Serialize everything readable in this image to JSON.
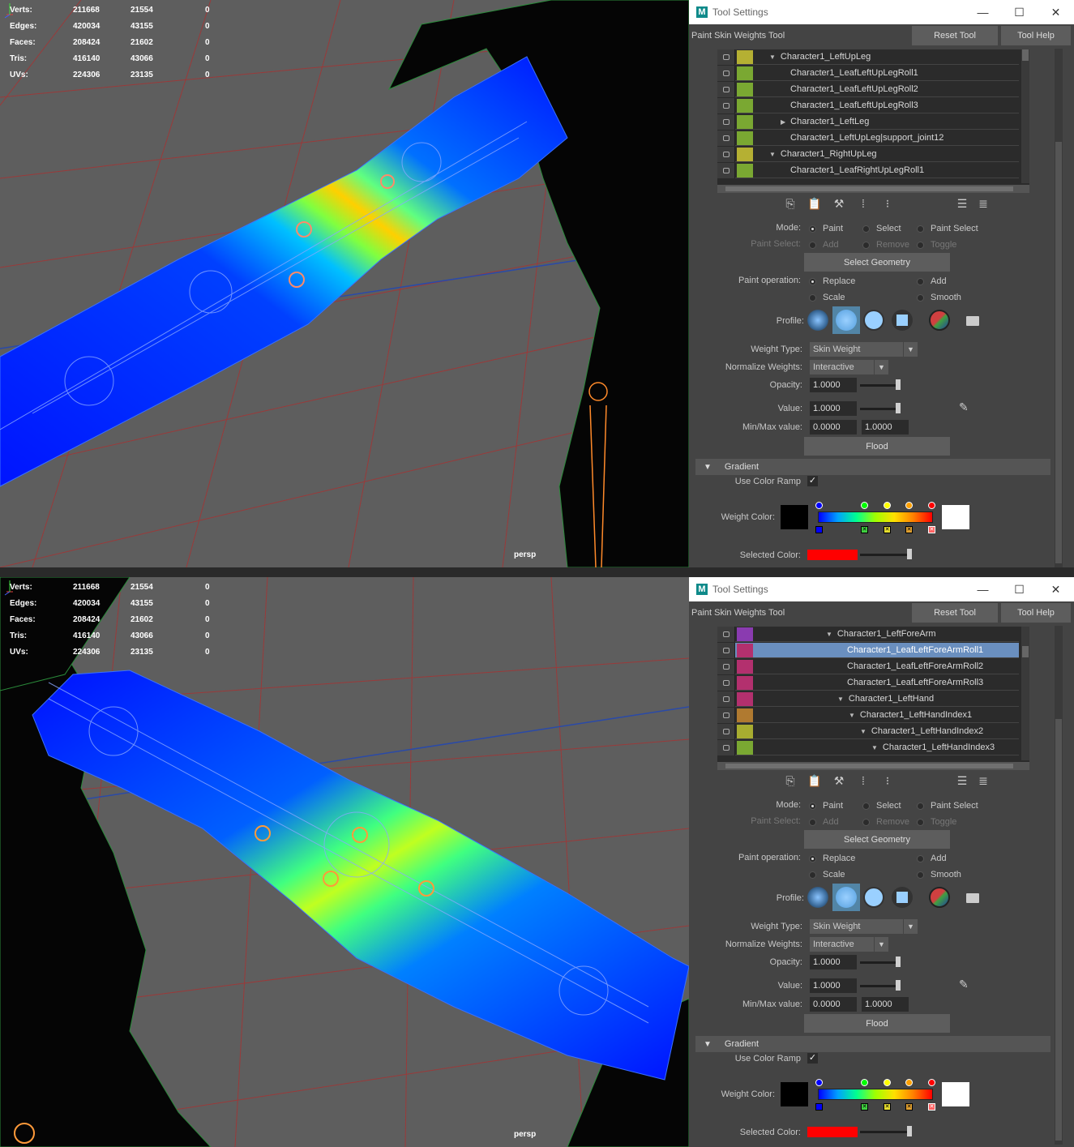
{
  "hud_stats": {
    "rows": [
      {
        "label": "Verts:",
        "v1": "211668",
        "v2": "21554",
        "v3": "0"
      },
      {
        "label": "Edges:",
        "v1": "420034",
        "v2": "43155",
        "v3": "0"
      },
      {
        "label": "Faces:",
        "v1": "208424",
        "v2": "21602",
        "v3": "0"
      },
      {
        "label": "Tris:",
        "v1": "416140",
        "v2": "43066",
        "v3": "0"
      },
      {
        "label": "UVs:",
        "v1": "224306",
        "v2": "23135",
        "v3": "0"
      }
    ]
  },
  "camera_label": "persp",
  "window": {
    "title": "Tool Settings",
    "minimize": "—",
    "maximize": "☐",
    "close": "✕"
  },
  "tool": {
    "name": "Paint Skin Weights Tool",
    "reset_label": "Reset Tool",
    "help_label": "Tool Help"
  },
  "joints_top": [
    {
      "name": "Character1_LeftUpLeg",
      "color": "#b5b033",
      "arrow": "▼"
    },
    {
      "name": "Character1_LeafLeftUpLegRoll1",
      "color": "#7aa832",
      "arrow": ""
    },
    {
      "name": "Character1_LeafLeftUpLegRoll2",
      "color": "#7aa832",
      "arrow": ""
    },
    {
      "name": "Character1_LeafLeftUpLegRoll3",
      "color": "#7aa832",
      "arrow": ""
    },
    {
      "name": "Character1_LeftLeg",
      "color": "#7aa832",
      "arrow": "▶"
    },
    {
      "name": "Character1_LeftUpLeg|support_joint12",
      "color": "#7aa832",
      "arrow": ""
    },
    {
      "name": "Character1_RightUpLeg",
      "color": "#b5b033",
      "arrow": "▼"
    },
    {
      "name": "Character1_LeafRightUpLegRoll1",
      "color": "#7aa832",
      "arrow": ""
    }
  ],
  "joints_bottom": [
    {
      "name": "Character1_LeftForeArm",
      "color": "#8a3bb0",
      "arrow": "▼"
    },
    {
      "name": "Character1_LeafLeftForeArmRoll1",
      "color": "#b3306e",
      "arrow": ""
    },
    {
      "name": "Character1_LeafLeftForeArmRoll2",
      "color": "#b3306e",
      "arrow": ""
    },
    {
      "name": "Character1_LeafLeftForeArmRoll3",
      "color": "#b3306e",
      "arrow": ""
    },
    {
      "name": "Character1_LeftHand",
      "color": "#b3306e",
      "arrow": "▼"
    },
    {
      "name": "Character1_LeftHandIndex1",
      "color": "#b07a30",
      "arrow": "▼"
    },
    {
      "name": "Character1_LeftHandIndex2",
      "color": "#a8ad30",
      "arrow": "▼"
    },
    {
      "name": "Character1_LeftHandIndex3",
      "color": "#7aa832",
      "arrow": "▼"
    }
  ],
  "mode": {
    "label": "Mode:",
    "paint": "Paint",
    "select": "Select",
    "paint_select": "Paint Select"
  },
  "paint_select": {
    "label": "Paint Select:",
    "add": "Add",
    "remove": "Remove",
    "toggle": "Toggle"
  },
  "select_geometry_label": "Select Geometry",
  "paint_operation": {
    "label": "Paint operation:",
    "replace": "Replace",
    "add": "Add",
    "scale": "Scale",
    "smooth": "Smooth"
  },
  "profile_label": "Profile:",
  "weight_type": {
    "label": "Weight Type:",
    "value": "Skin Weight"
  },
  "normalize": {
    "label": "Normalize Weights:",
    "value": "Interactive"
  },
  "opacity": {
    "label": "Opacity:",
    "value": "1.0000",
    "level": 1.0
  },
  "value": {
    "label": "Value:",
    "value": "1.0000",
    "level": 1.0
  },
  "minmax": {
    "label": "Min/Max value:",
    "min": "0.0000",
    "max": "1.0000"
  },
  "flood_label": "Flood",
  "gradient": {
    "section": "Gradient",
    "use_ramp_label": "Use Color Ramp",
    "weight_color_label": "Weight Color:",
    "selected_color_label": "Selected Color:",
    "check": "✓"
  },
  "colors": {
    "selected_color": "#ff0000",
    "panel_bg": "#444444",
    "viewport_bg": "#5e5e5e",
    "selection_row": "#6a8fbf"
  }
}
